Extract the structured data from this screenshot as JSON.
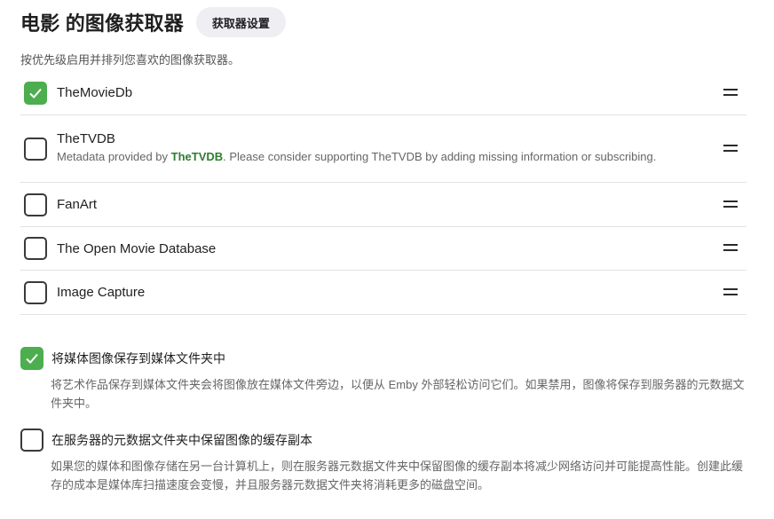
{
  "header": {
    "title": "电影 的图像获取器",
    "settings_button": "获取器设置"
  },
  "description": "按优先级启用并排列您喜欢的图像获取器。",
  "fetchers": [
    {
      "name": "TheMovieDb",
      "checked": true
    },
    {
      "name": "TheTVDB",
      "checked": false,
      "sub_prefix": "Metadata provided by ",
      "sub_link": "TheTVDB",
      "sub_suffix": ". Please consider supporting TheTVDB by adding missing information or subscribing."
    },
    {
      "name": "FanArt",
      "checked": false
    },
    {
      "name": "The Open Movie Database",
      "checked": false
    },
    {
      "name": "Image Capture",
      "checked": false
    }
  ],
  "options": [
    {
      "label": "将媒体图像保存到媒体文件夹中",
      "checked": true,
      "help": "将艺术作品保存到媒体文件夹会将图像放在媒体文件旁边，以便从 Emby 外部轻松访问它们。如果禁用，图像将保存到服务器的元数据文件夹中。"
    },
    {
      "label": "在服务器的元数据文件夹中保留图像的缓存副本",
      "checked": false,
      "help": "如果您的媒体和图像存储在另一台计算机上，则在服务器元数据文件夹中保留图像的缓存副本将减少网络访问并可能提高性能。创建此缓存的成本是媒体库扫描速度会变慢，并且服务器元数据文件夹将消耗更多的磁盘空间。"
    }
  ],
  "colors": {
    "accent": "#4cae4f",
    "link": "#2e7d32"
  },
  "icons": {
    "check": "check-icon",
    "drag": "drag-handle-icon"
  }
}
